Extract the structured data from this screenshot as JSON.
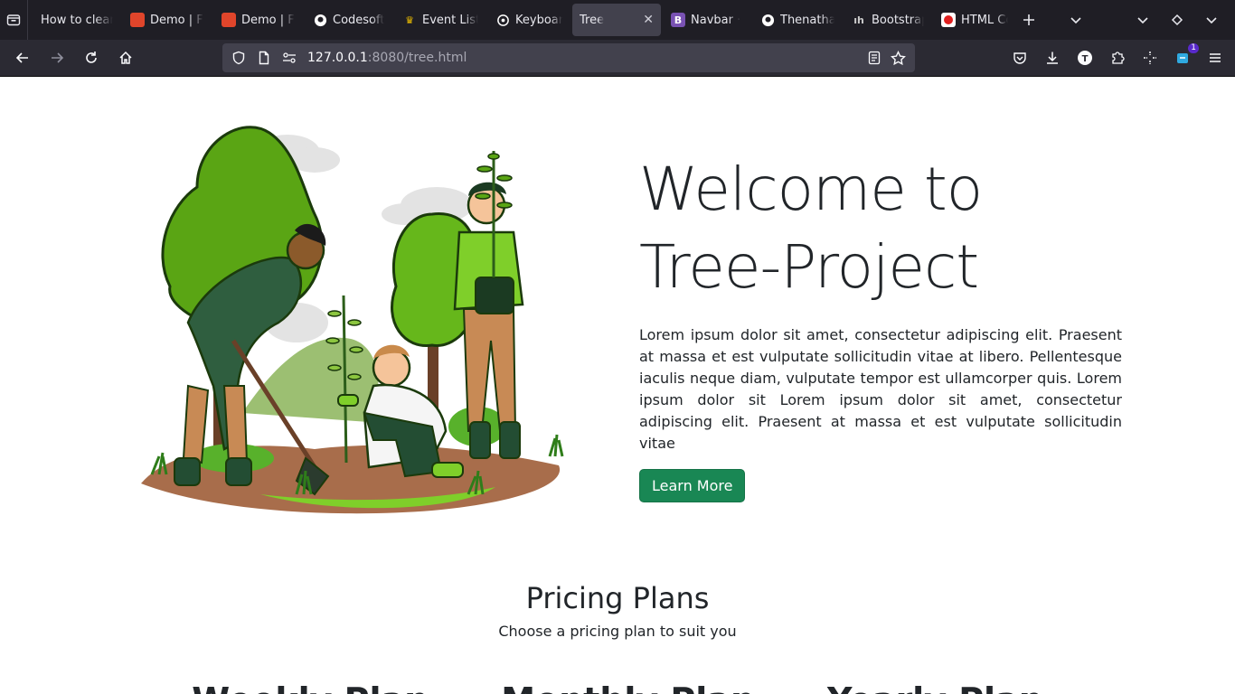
{
  "browser": {
    "tabs": [
      {
        "label": "How to clean",
        "icon": "none-icon",
        "color": ""
      },
      {
        "label": "Demo | F",
        "icon": "square-logo-icon",
        "color": "#e0452b"
      },
      {
        "label": "Demo | F",
        "icon": "square-logo-icon",
        "color": "#e0452b"
      },
      {
        "label": "Codesoft",
        "icon": "github-icon",
        "color": "#ffffff"
      },
      {
        "label": "Event List",
        "icon": "crown-icon",
        "color": "#f0c000"
      },
      {
        "label": "Keyboard",
        "icon": "openai-icon",
        "color": "#ffffff"
      },
      {
        "label": "Tree",
        "icon": "none-icon",
        "color": "",
        "active": true
      },
      {
        "label": "Navbar ·",
        "icon": "bootstrap-icon",
        "color": "#7952b3"
      },
      {
        "label": "Thenatha",
        "icon": "github-icon",
        "color": "#ffffff"
      },
      {
        "label": "Bootstrap",
        "icon": "h-logo-icon",
        "color": "#cccccc"
      },
      {
        "label": "HTML Co",
        "icon": "red-circle-icon",
        "color": "#e02020"
      }
    ],
    "url": {
      "host": "127.0.0.1",
      "path": ":8080/tree.html"
    },
    "extension_badge": "1"
  },
  "hero": {
    "title_line1": "Welcome to",
    "title_line2": "Tree-Project",
    "paragraph": "Lorem ipsum dolor sit amet, consectetur adipiscing elit. Praesent at massa et est vulputate sollicitudin vitae at libero. Pellentesque iaculis neque diam, vulputate tempor est ullamcorper quis. Lorem ipsum dolor sit Lorem ipsum dolor sit amet, consectetur adipiscing elit. Praesent at massa et est vulputate sollicitudin vitae",
    "button": "Learn More"
  },
  "pricing": {
    "title": "Pricing Plans",
    "subtitle": "Choose a pricing plan to suit you",
    "plans": [
      "Weekly Plan",
      "Monthly Plan",
      "Yearly Plan"
    ]
  }
}
